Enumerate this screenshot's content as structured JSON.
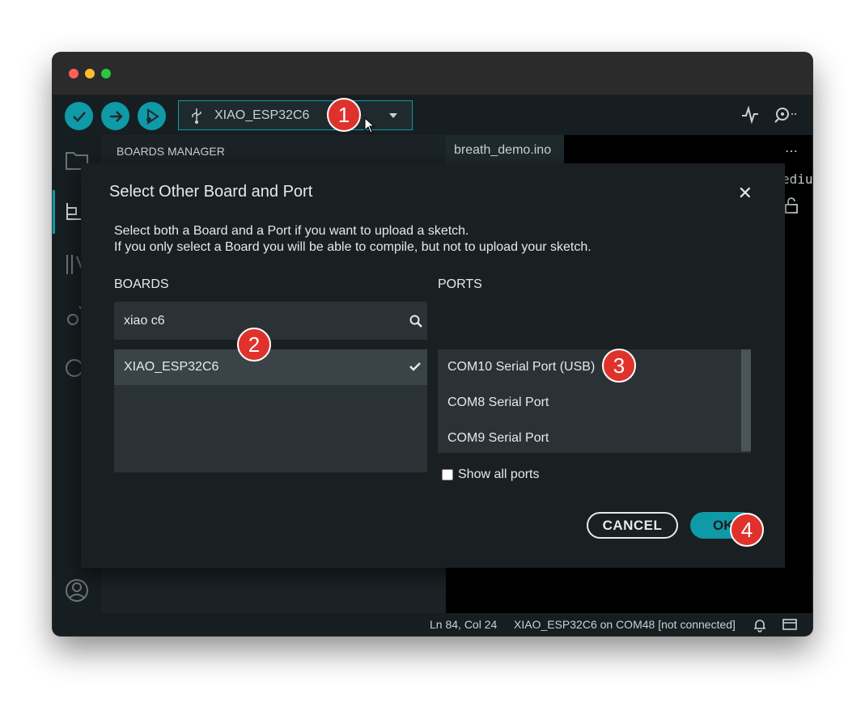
{
  "toolbar": {
    "verify_label": "Verify",
    "upload_label": "Upload",
    "debug_label": "Debug",
    "board_selector": "XIAO_ESP32C6"
  },
  "sidebar": {
    "header": "BOARDS MANAGER"
  },
  "editor": {
    "tab": "breath_demo.ino",
    "partial_text": "ediu"
  },
  "statusbar": {
    "position": "Ln 84, Col 24",
    "board_port": "XIAO_ESP32C6 on COM48 [not connected]"
  },
  "dialog": {
    "title": "Select Other Board and Port",
    "description_line1": "Select both a Board and a Port if you want to upload a sketch.",
    "description_line2": "If you only select a Board you will be able to compile, but not to upload your sketch.",
    "boards_label": "BOARDS",
    "ports_label": "PORTS",
    "search_value": "xiao c6",
    "boards": [
      "XIAO_ESP32C6"
    ],
    "ports": [
      "COM10 Serial Port (USB)",
      "COM8 Serial Port",
      "COM9 Serial Port"
    ],
    "show_all_ports": "Show all ports",
    "cancel_label": "CANCEL",
    "ok_label": "OK"
  },
  "annotations": [
    "1",
    "2",
    "3",
    "4"
  ],
  "colors": {
    "accent": "#0e9aa7",
    "badge": "#e0322d",
    "dialog_bg": "#1a1f22"
  }
}
